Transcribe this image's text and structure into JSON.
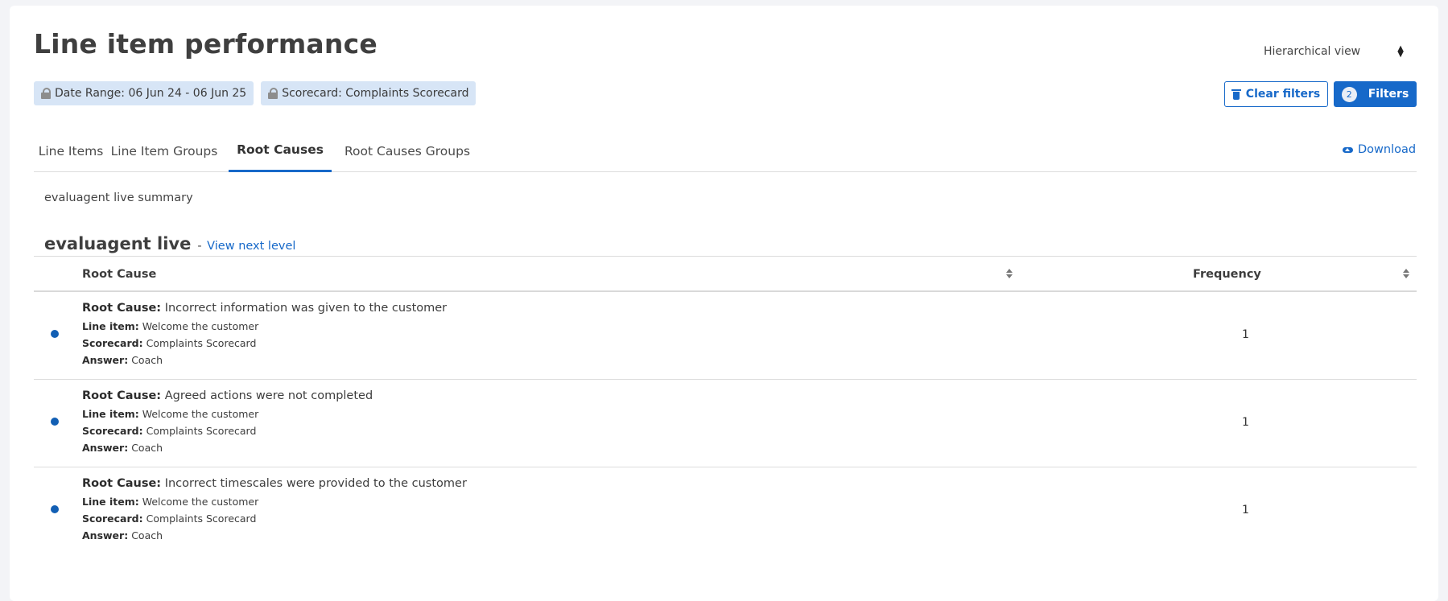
{
  "page": {
    "title": "Line item performance",
    "view_select": "Hierarchical view"
  },
  "chips": [
    {
      "label": "Date Range: 06 Jun 24 - 06 Jun 25"
    },
    {
      "label": "Scorecard: Complaints Scorecard"
    }
  ],
  "actions": {
    "clear_filters": "Clear filters",
    "filters_label": "Filters",
    "filters_count": "2",
    "download": "Download"
  },
  "tabs": [
    {
      "label": "Line Items",
      "active": false
    },
    {
      "label": "Line Item Groups",
      "active": false
    },
    {
      "label": "Root Causes",
      "active": true
    },
    {
      "label": "Root Causes Groups",
      "active": false
    }
  ],
  "summary": "evaluagent live summary",
  "section": {
    "title": "evaluagent live",
    "dash": "-",
    "link": "View next level"
  },
  "table": {
    "columns": [
      "Root Cause",
      "Frequency"
    ],
    "field_labels": {
      "root_cause": "Root Cause:",
      "line_item": "Line item:",
      "scorecard": "Scorecard:",
      "answer": "Answer:"
    },
    "rows": [
      {
        "root_cause": "Incorrect information was given to the customer",
        "line_item": "Welcome the customer",
        "scorecard": "Complaints Scorecard",
        "answer": "Coach",
        "frequency": "1"
      },
      {
        "root_cause": "Agreed actions were not completed",
        "line_item": "Welcome the customer",
        "scorecard": "Complaints Scorecard",
        "answer": "Coach",
        "frequency": "1"
      },
      {
        "root_cause": "Incorrect timescales were provided to the customer",
        "line_item": "Welcome the customer",
        "scorecard": "Complaints Scorecard",
        "answer": "Coach",
        "frequency": "1"
      }
    ]
  },
  "colors": {
    "accent": "#1769c9",
    "chip_bg": "#d7e5f6",
    "dot": "#125fb4"
  },
  "icons": [
    "lock-icon",
    "trash-icon",
    "upload-cloud-icon",
    "sort-icon",
    "select-arrows-icon"
  ]
}
